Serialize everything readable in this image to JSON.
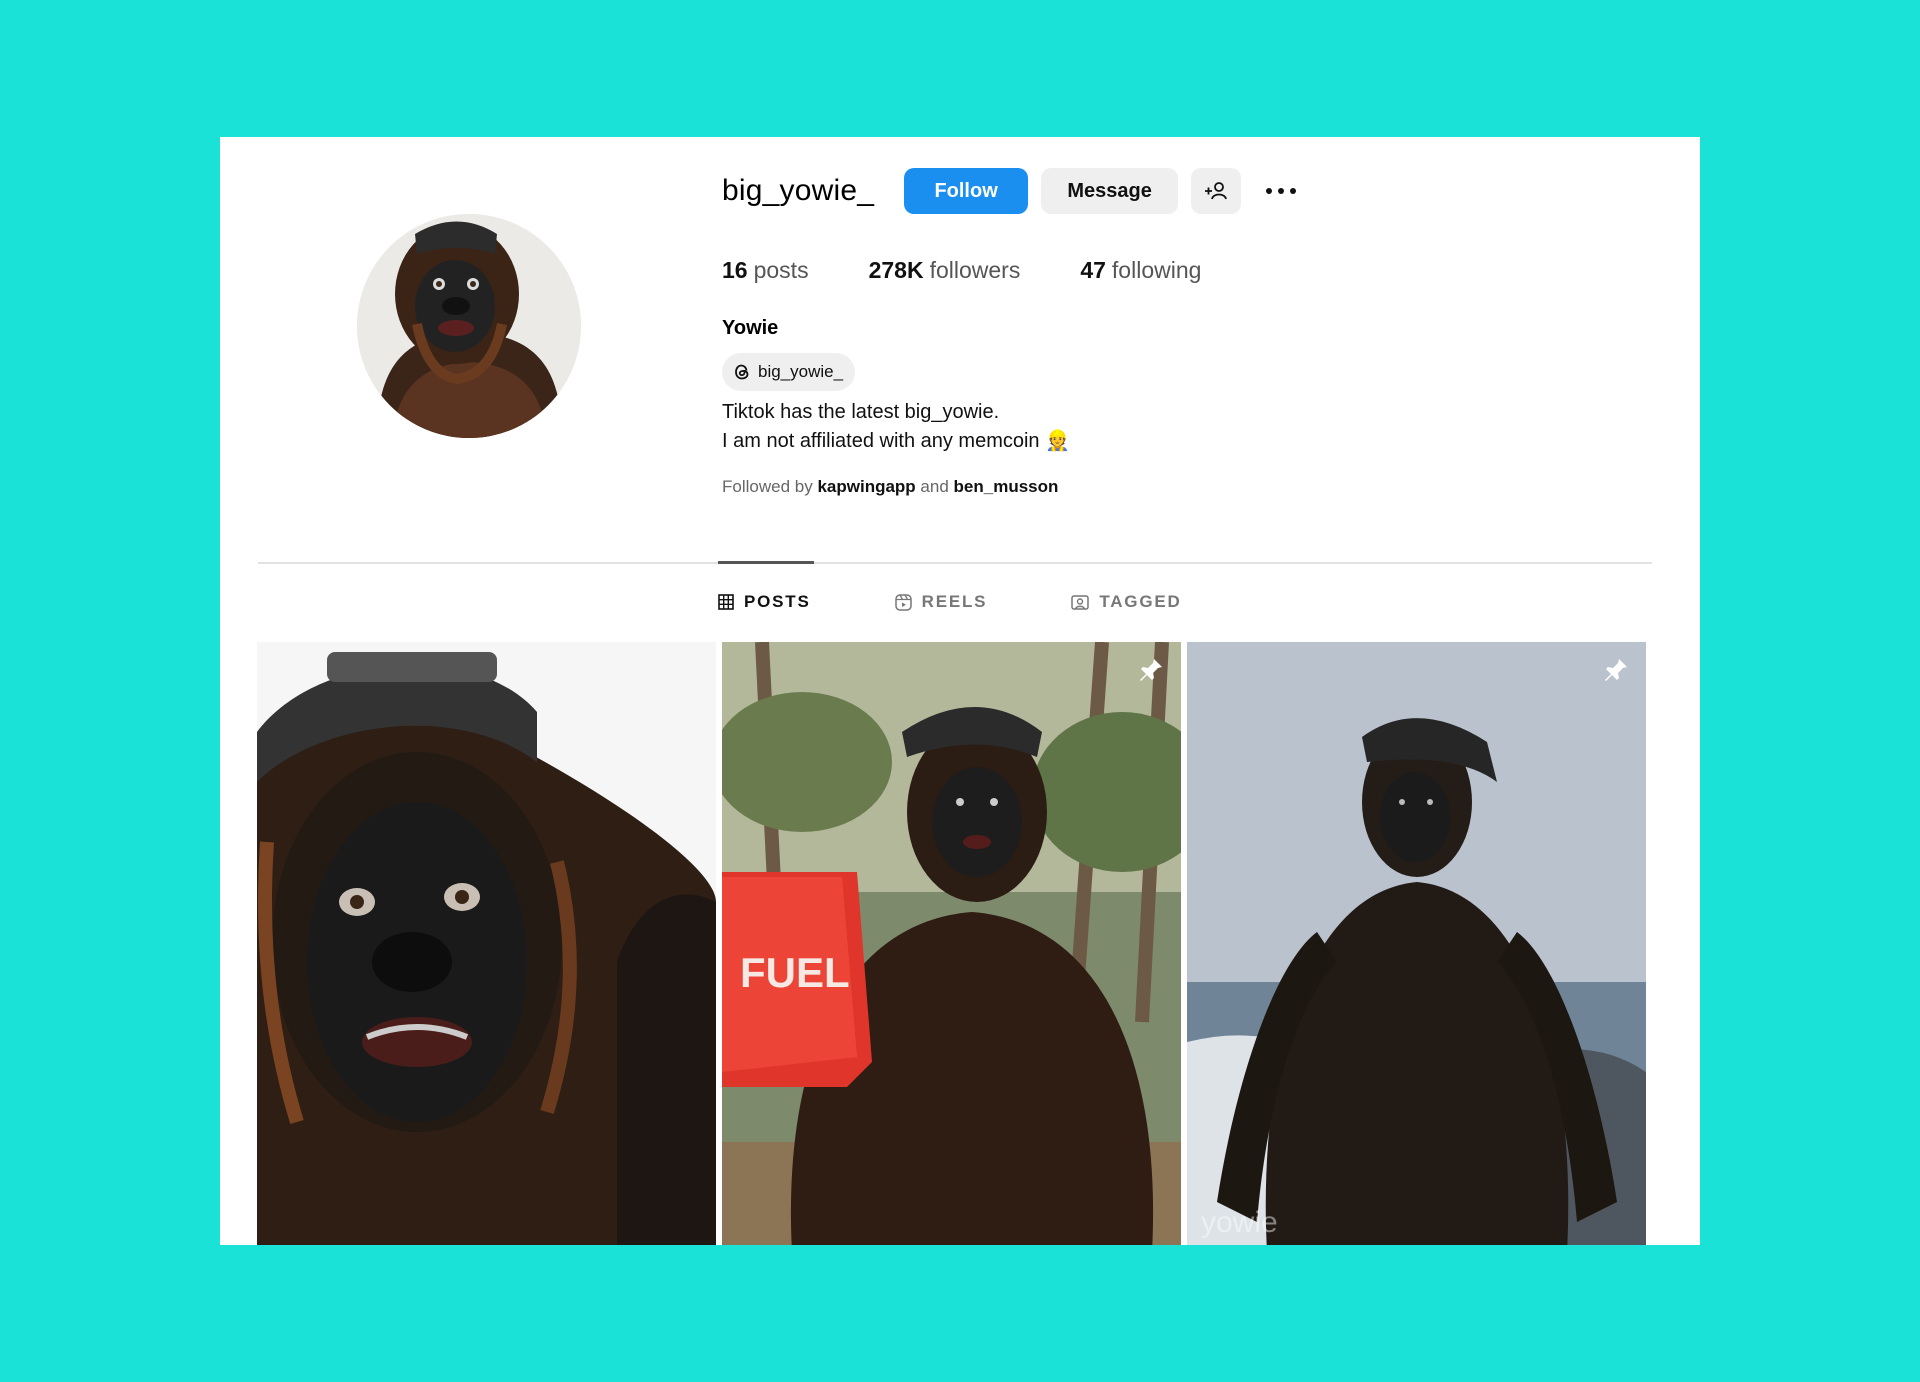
{
  "profile": {
    "username": "big_yowie_",
    "follow_label": "Follow",
    "message_label": "Message",
    "display_name": "Yowie",
    "threads_handle": "big_yowie_",
    "bio_line1": "Tiktok has the latest big_yowie.",
    "bio_line2": "I am not affiliated with any memcoin 👷",
    "followed_by_prefix": "Followed by",
    "followed_by_user1": "kapwingapp",
    "followed_by_and": "and",
    "followed_by_user2": "ben_musson"
  },
  "stats": {
    "posts_count": "16",
    "posts_label": "posts",
    "followers_count": "278K",
    "followers_label": "followers",
    "following_count": "47",
    "following_label": "following"
  },
  "tabs": [
    {
      "label": "POSTS",
      "icon": "grid-icon",
      "active": true
    },
    {
      "label": "REELS",
      "icon": "reels-icon",
      "active": false
    },
    {
      "label": "TAGGED",
      "icon": "tagged-icon",
      "active": false
    }
  ],
  "posts": [
    {
      "pinned": false
    },
    {
      "pinned": true,
      "sign_text": "FUEL"
    },
    {
      "pinned": true,
      "watermark": "yowie"
    }
  ],
  "colors": {
    "background": "#1ae2d6",
    "follow_button": "#1a8ff0",
    "secondary_button": "#efefef"
  }
}
